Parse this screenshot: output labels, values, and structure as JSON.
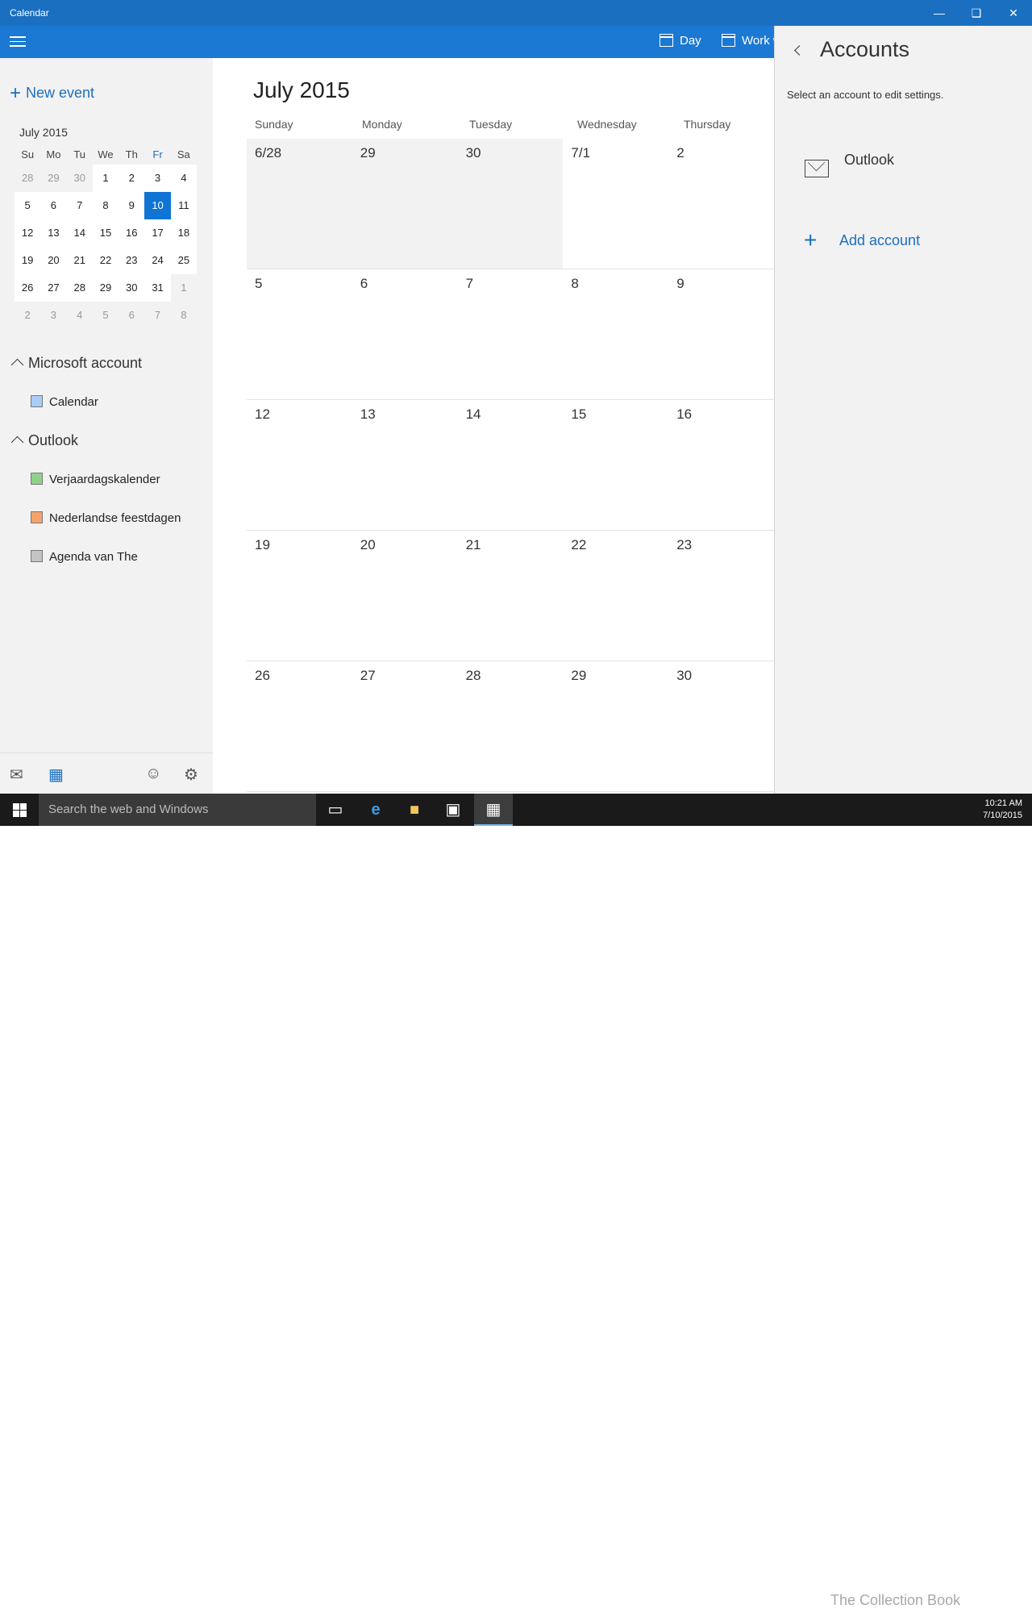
{
  "window": {
    "title": "Calendar",
    "controls": [
      "minimize",
      "restore",
      "close"
    ]
  },
  "toolbar": {
    "day_label": "Day",
    "workweek_label": "Work w"
  },
  "sidebar": {
    "new_event": "New event",
    "mini_calendar": {
      "title": "July 2015",
      "weekdays": [
        "Su",
        "Mo",
        "Tu",
        "We",
        "Th",
        "Fr",
        "Sa"
      ],
      "weeks": [
        [
          "28",
          "29",
          "30",
          "1",
          "2",
          "3",
          "4"
        ],
        [
          "5",
          "6",
          "7",
          "8",
          "9",
          "10",
          "11"
        ],
        [
          "12",
          "13",
          "14",
          "15",
          "16",
          "17",
          "18"
        ],
        [
          "19",
          "20",
          "21",
          "22",
          "23",
          "24",
          "25"
        ],
        [
          "26",
          "27",
          "28",
          "29",
          "30",
          "31",
          "1"
        ],
        [
          "2",
          "3",
          "4",
          "5",
          "6",
          "7",
          "8"
        ]
      ],
      "selected": "10"
    },
    "groups": [
      {
        "name": "Microsoft account",
        "calendars": [
          {
            "name": "Calendar",
            "color": "#a9cdf5"
          }
        ]
      },
      {
        "name": "Outlook",
        "calendars": [
          {
            "name": "Verjaardagskalender",
            "color": "#8fd18b"
          },
          {
            "name": "Nederlandse feestdagen",
            "color": "#f4a46a"
          },
          {
            "name": "Agenda van The",
            "color": "#c4c4c4"
          }
        ]
      }
    ]
  },
  "main": {
    "month_title": "July 2015",
    "days_of_week": [
      "Sunday",
      "Monday",
      "Tuesday",
      "Wednesday",
      "Thursday"
    ],
    "weeks": [
      [
        "6/28",
        "29",
        "30",
        "7/1",
        "2"
      ],
      [
        "5",
        "6",
        "7",
        "8",
        "9"
      ],
      [
        "12",
        "13",
        "14",
        "15",
        "16"
      ],
      [
        "19",
        "20",
        "21",
        "22",
        "23"
      ],
      [
        "26",
        "27",
        "28",
        "29",
        "30"
      ]
    ]
  },
  "panel": {
    "title": "Accounts",
    "subtitle": "Select an account to edit settings.",
    "account": "Outlook",
    "add_account": "Add account"
  },
  "taskbar": {
    "search_placeholder": "Search the web and Windows",
    "time": "10:21 AM",
    "date": "7/10/2015",
    "watermark": "The Collection Book"
  },
  "colors": {
    "accent": "#1a6fc1",
    "toolbar": "#1b79d3",
    "today": "#0f74d4"
  }
}
